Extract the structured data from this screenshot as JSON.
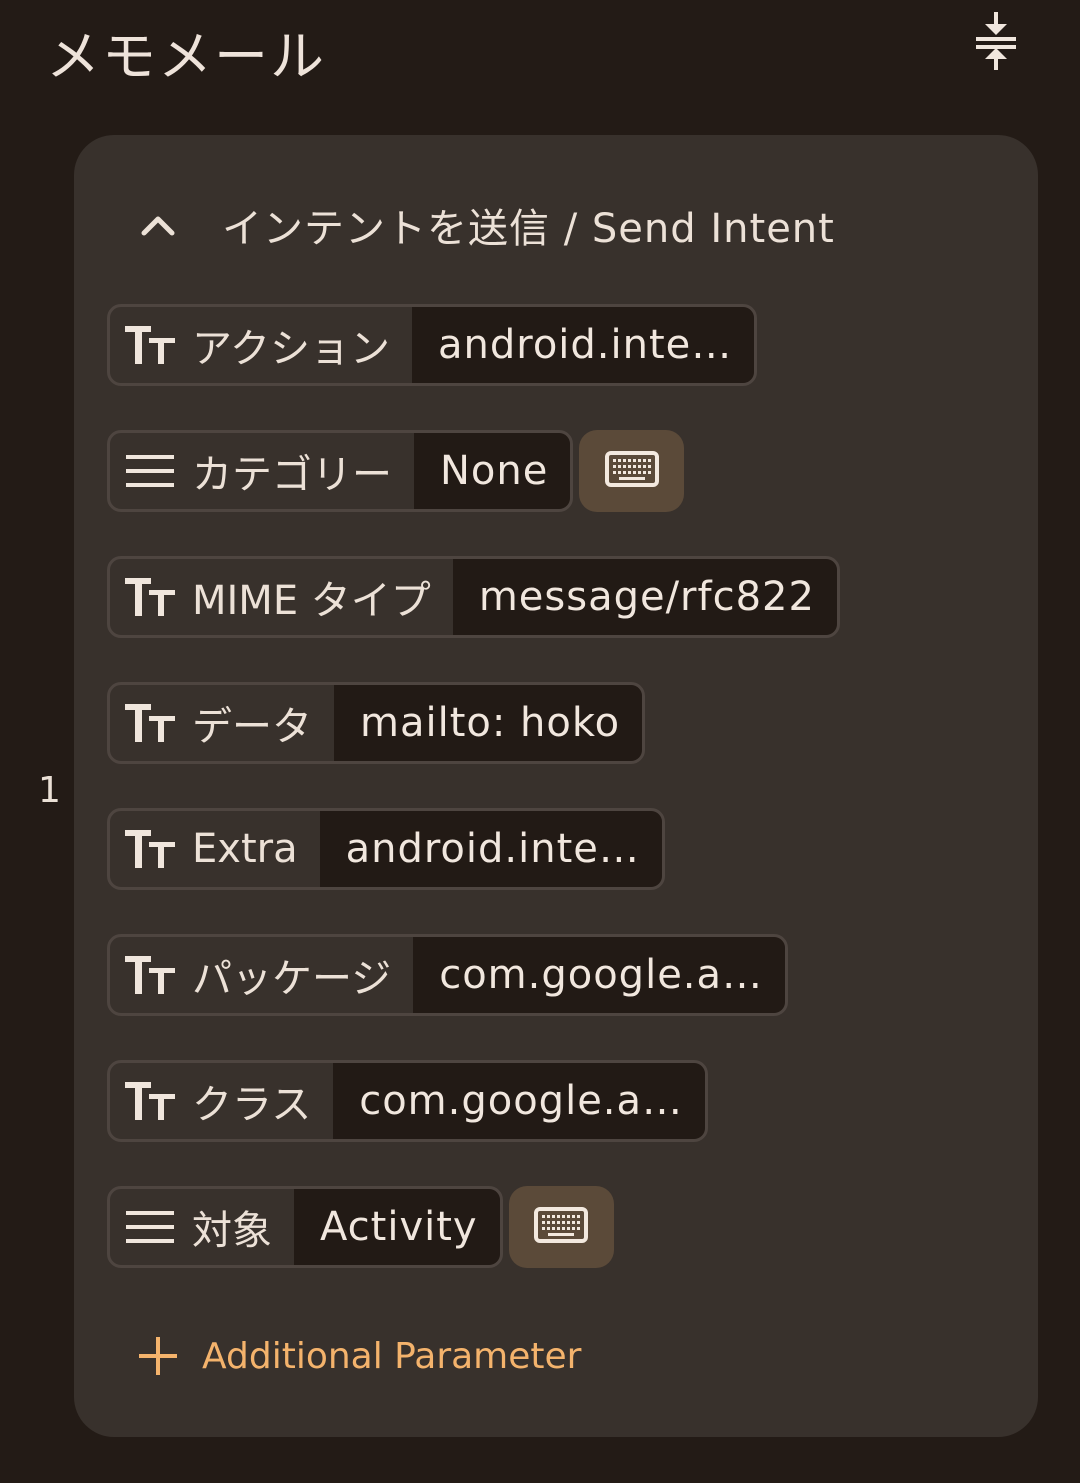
{
  "header": {
    "title": "メモメール",
    "collapse_icon": "vertical-collapse-icon"
  },
  "line_number": "1",
  "card": {
    "title": "インテントを送信 / Send Intent",
    "expand_icon": "chevron-up-icon",
    "params": [
      {
        "icon": "text-type-icon",
        "label": "アクション",
        "value": "android.inte…",
        "has_keyboard": false
      },
      {
        "icon": "list-menu-icon",
        "label": "カテゴリー",
        "value": "None",
        "has_keyboard": true
      },
      {
        "icon": "text-type-icon",
        "label": "MIME タイプ",
        "value": "message/rfc822",
        "has_keyboard": false
      },
      {
        "icon": "text-type-icon",
        "label": "データ",
        "value": "mailto: hoko",
        "has_keyboard": false
      },
      {
        "icon": "text-type-icon",
        "label": "Extra",
        "value": "android.inte…",
        "has_keyboard": false
      },
      {
        "icon": "text-type-icon",
        "label": "パッケージ",
        "value": "com.google.a…",
        "has_keyboard": false
      },
      {
        "icon": "text-type-icon",
        "label": "クラス",
        "value": "com.google.a…",
        "has_keyboard": false
      },
      {
        "icon": "list-menu-icon",
        "label": "対象",
        "value": "Activity",
        "has_keyboard": true
      }
    ],
    "keyboard_icon": "keyboard-icon",
    "add_parameter_label": "Additional Parameter",
    "add_icon": "plus-icon"
  },
  "colors": {
    "background": "#231b16",
    "card": "#38312c",
    "value_bg": "#221a15",
    "keyboard_button": "#5b4a39",
    "accent": "#f4b36c"
  }
}
